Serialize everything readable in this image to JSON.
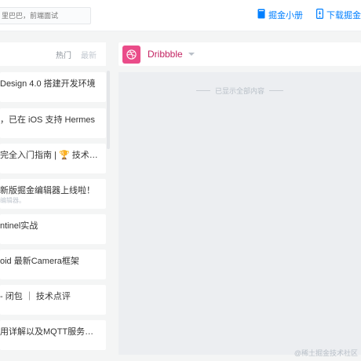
{
  "header": {
    "search_placeholder": "里巴巴，前端面试",
    "book_link": "掘金小册",
    "app_link": "下载掘金"
  },
  "feed": {
    "tab_hot": "热门",
    "tab_new": "最新",
    "items": [
      {
        "title": "Design 4.0 搭建开发环境",
        "sub": ""
      },
      {
        "title": "，已在 iOS 支持 Hermes",
        "sub": ""
      },
      {
        "title": "完全入门指南 | 🏆 技术…",
        "sub": ""
      },
      {
        "title": "新版掘金编辑器上线啦！",
        "sub": "编辑器。"
      },
      {
        "title": "ntinel实战",
        "sub": ""
      },
      {
        "title": "oid 最新Camera框架",
        "sub": ""
      },
      {
        "title": "- 闭包 ｜ 技术点评",
        "sub": ""
      },
      {
        "title": "用详解以及MQTT服务…",
        "sub": ""
      }
    ]
  },
  "category": {
    "name": "Dribbble",
    "empty_text": "已显示全部内容",
    "logo_color": "#ea4c89",
    "name_color": "#c32361"
  },
  "watermark": "@稀土掘金技术社区",
  "colors": {
    "accent": "#007fff"
  }
}
